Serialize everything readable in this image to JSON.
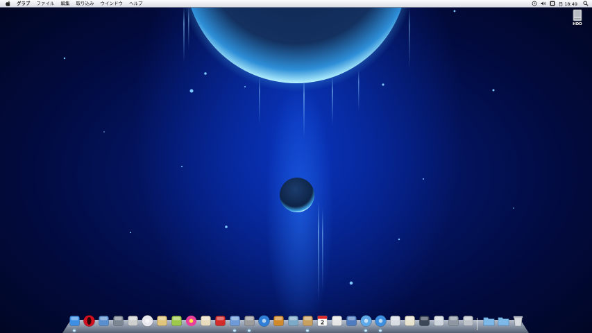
{
  "menubar": {
    "apple_icon": "apple-logo-icon",
    "app_name": "グラブ",
    "items": [
      "ファイル",
      "編集",
      "取り込み",
      "ウインドウ",
      "ヘルプ"
    ],
    "status_icons": [
      "time-machine-icon",
      "volume-icon",
      "input-method-icon"
    ],
    "clock": "日 18:49",
    "spotlight_icon": "spotlight-icon"
  },
  "desktop": {
    "drive_label": "HDD",
    "drive_icon": "hard-drive-icon"
  },
  "dock": {
    "apps": [
      {
        "icon": "finder-icon",
        "color": "#3d8fe6"
      },
      {
        "icon": "opera-icon",
        "color": "#d51020"
      },
      {
        "icon": "preview-icon",
        "color": "#5a8fd0"
      },
      {
        "icon": "screen-sharing-icon",
        "color": "#7d8794"
      },
      {
        "icon": "ipod-icon",
        "color": "#cfcfcf"
      },
      {
        "icon": "disc-utility-icon",
        "color": "#e8e8ee"
      },
      {
        "icon": "package-icon",
        "color": "#e0c57a"
      },
      {
        "icon": "textedit-icon",
        "color": "#9ec84a"
      },
      {
        "icon": "flower-icon",
        "color": "#e83e9c"
      },
      {
        "icon": "script-editor-icon",
        "color": "#e8dcc0"
      },
      {
        "icon": "chess-icon",
        "color": "#d42a2a"
      },
      {
        "icon": "iphoto-icon",
        "color": "#6e9bd8"
      },
      {
        "icon": "imovie-icon",
        "color": "#9c9c9c"
      },
      {
        "icon": "dvd-player-icon",
        "color": "#2f7ed8"
      },
      {
        "icon": "garageband-icon",
        "color": "#d08a2c"
      },
      {
        "icon": "network-icon",
        "color": "#7da9c8"
      },
      {
        "icon": "address-book-icon",
        "color": "#c8a060"
      },
      {
        "icon": "ical-icon",
        "color": "#ffffff"
      },
      {
        "icon": "dictionary-icon",
        "color": "#e6e6e6"
      },
      {
        "icon": "photo-booth-icon",
        "color": "#4f7cc0"
      },
      {
        "icon": "itunes-icon",
        "color": "#5fa8e8"
      },
      {
        "icon": "safari-icon",
        "color": "#3c8fe0"
      },
      {
        "icon": "mail-icon",
        "color": "#d8dde4"
      },
      {
        "icon": "stickies-icon",
        "color": "#e8e4d0"
      },
      {
        "icon": "dashboard-icon",
        "color": "#3b4656"
      },
      {
        "icon": "exposé-icon",
        "color": "#cfd6de"
      },
      {
        "icon": "activity-monitor-icon",
        "color": "#8e97a2"
      },
      {
        "icon": "printer-icon",
        "color": "#bfc4ca"
      },
      {
        "icon": "applications-folder-icon",
        "color": "#7cb8e8"
      },
      {
        "icon": "downloads-folder-icon",
        "color": "#7cb8e8"
      },
      {
        "icon": "trash-icon",
        "color": "#d7dbe0"
      }
    ],
    "calendar_day": "2",
    "running_indicators": [
      0,
      11,
      12,
      16,
      20,
      21
    ]
  }
}
